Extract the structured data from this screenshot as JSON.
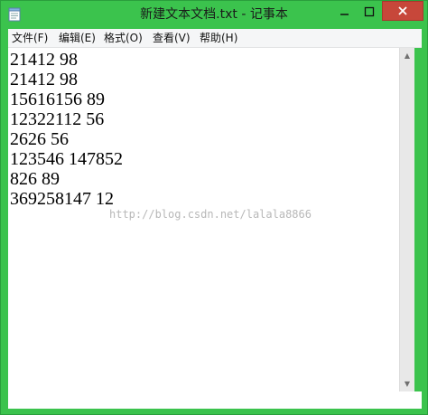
{
  "window": {
    "title": "新建文本文档.txt - 记事本",
    "controls": {
      "minimize": "─",
      "maximize": "□",
      "close": "✕"
    }
  },
  "menu": {
    "items": [
      {
        "label": "文件(F)"
      },
      {
        "label": "编辑(E)"
      },
      {
        "label": "格式(O)"
      },
      {
        "label": "查看(V)"
      },
      {
        "label": "帮助(H)"
      }
    ]
  },
  "document": {
    "lines": [
      "21412 98",
      "21412 98",
      "15616156 89",
      "12322112 56",
      "2626 56",
      "123546 147852",
      "826 89",
      "369258147 12"
    ],
    "watermark": "http://blog.csdn.net/lalala8866"
  },
  "scrollbar": {
    "up": "▲",
    "down": "▼"
  },
  "colors": {
    "frame": "#3bc34d",
    "close_button": "#c7473a",
    "editor_bg": "#ffffff"
  }
}
